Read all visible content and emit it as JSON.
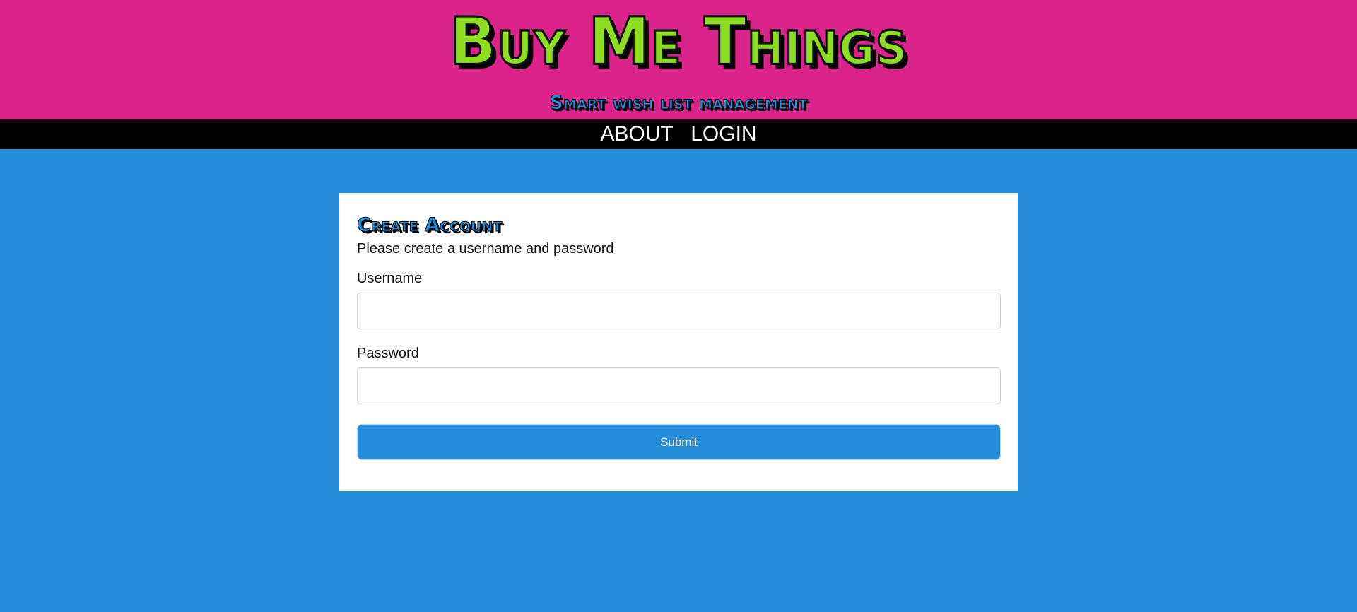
{
  "header": {
    "title": "Buy Me Things",
    "subtitle": "Smart wish list management"
  },
  "nav": {
    "about_label": "ABOUT",
    "login_label": "LOGIN"
  },
  "form": {
    "title": "Create Account",
    "description": "Please create a username and password",
    "username_label": "Username",
    "username_value": "",
    "password_label": "Password",
    "password_value": "",
    "submit_label": "Submit"
  },
  "colors": {
    "header_background": "#da248b",
    "title_color": "#8ddd22",
    "accent_blue": "#268ddb",
    "navbar_background": "#000000",
    "card_background": "#ffffff"
  }
}
